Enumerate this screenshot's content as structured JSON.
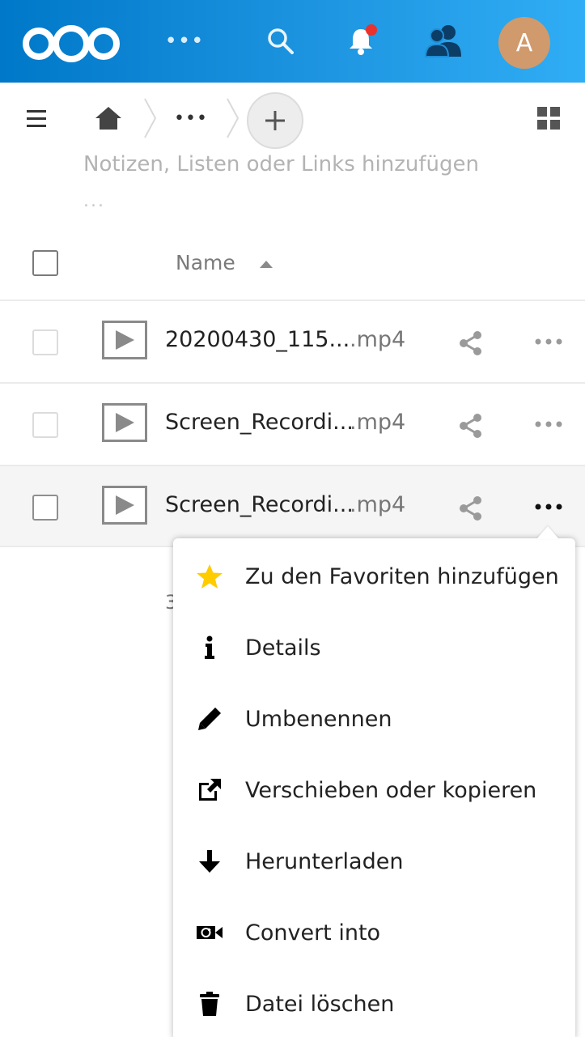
{
  "header": {
    "avatar_initial": "A",
    "apps_label": "•••",
    "brand_color": "#0082c9",
    "notification_dot_color": "#e9322d"
  },
  "toolbar": {
    "breadcrumb_more": "•••",
    "add_label": "+",
    "notes_placeholder": "Notizen, Listen oder Links hinzufügen",
    "notes_more": "..."
  },
  "table": {
    "column_name": "Name",
    "sort": "ascending",
    "rows": [
      {
        "name": "20200430_115...",
        "ext": ".mp4"
      },
      {
        "name": "Screen_Recordi...",
        "ext": ".mp4"
      },
      {
        "name": "Screen_Recordi...",
        "ext": ".mp4"
      }
    ],
    "footer_partial": "3"
  },
  "context_menu": {
    "items": [
      {
        "label": "Zu den Favoriten hinzufügen",
        "icon": "star-icon"
      },
      {
        "label": "Details",
        "icon": "info-icon"
      },
      {
        "label": "Umbenennen",
        "icon": "pencil-icon"
      },
      {
        "label": "Verschieben oder kopieren",
        "icon": "external-link-icon"
      },
      {
        "label": "Herunterladen",
        "icon": "download-arrow-icon"
      },
      {
        "label": "Convert into",
        "icon": "video-convert-icon"
      },
      {
        "label": "Datei löschen",
        "icon": "trash-icon"
      }
    ],
    "star_color": "#fc0"
  }
}
